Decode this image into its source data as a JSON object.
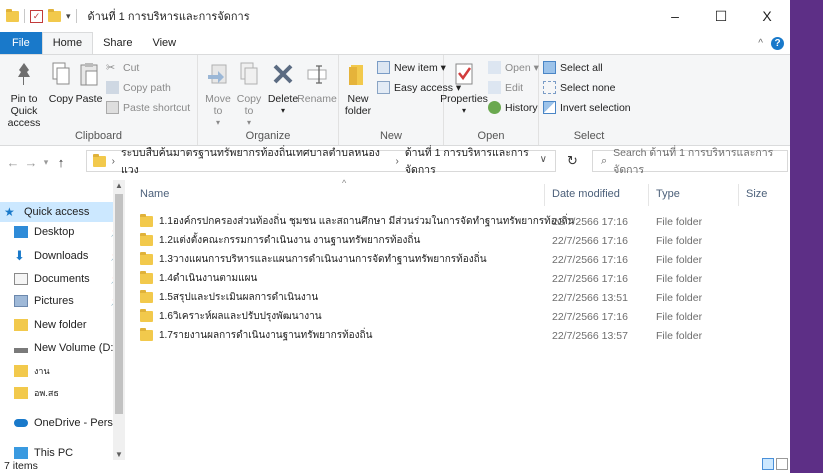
{
  "window": {
    "title": "ด้านที่ 1 การบริหารและการจัดการ",
    "controls": {
      "minimize": "–",
      "maximize": "☐",
      "close": "X"
    }
  },
  "ribbon_tabs": [
    "File",
    "Home",
    "Share",
    "View"
  ],
  "ribbon": {
    "clipboard": {
      "label": "Clipboard",
      "pin_to_quick_access": "Pin to Quick access",
      "copy": "Copy",
      "paste": "Paste",
      "cut": "Cut",
      "copy_path": "Copy path",
      "paste_shortcut": "Paste shortcut"
    },
    "organize": {
      "label": "Organize",
      "move_to": "Move to",
      "copy_to": "Copy to",
      "delete": "Delete",
      "rename": "Rename"
    },
    "new": {
      "label": "New",
      "new_folder": "New folder",
      "new_item": "New item ▾",
      "easy_access": "Easy access ▾"
    },
    "open": {
      "label": "Open",
      "properties": "Properties",
      "open": "Open ▾",
      "edit": "Edit",
      "history": "History"
    },
    "select": {
      "label": "Select",
      "select_all": "Select all",
      "select_none": "Select none",
      "invert_selection": "Invert selection"
    }
  },
  "address": {
    "crumbs": [
      "ระบบสืบค้นมาตรฐานทรัพยากรท้องถิ่นเทศบาลตำบลหนองแวง",
      "ด้านที่ 1 การบริหารและการจัดการ"
    ],
    "search_placeholder": "Search ด้านที่ 1 การบริหารและการจัดการ"
  },
  "nav_items": [
    {
      "label": "Quick access",
      "icon": "star-icon",
      "pinned": false
    },
    {
      "label": "Desktop",
      "icon": "desktop-icon",
      "pinned": true
    },
    {
      "label": "Downloads",
      "icon": "download-icon",
      "pinned": true
    },
    {
      "label": "Documents",
      "icon": "document-icon",
      "pinned": true
    },
    {
      "label": "Pictures",
      "icon": "pictures-icon",
      "pinned": true
    },
    {
      "label": "New folder",
      "icon": "folder-icon",
      "pinned": false
    },
    {
      "label": "New Volume (D:",
      "icon": "drive-icon",
      "pinned": false
    },
    {
      "label": "งาน",
      "icon": "folder-icon",
      "pinned": false
    },
    {
      "label": "อพ.สธ",
      "icon": "folder-icon",
      "pinned": false
    },
    {
      "label": "OneDrive - Persor",
      "icon": "cloud-icon",
      "pinned": false
    },
    {
      "label": "This PC",
      "icon": "pc-icon",
      "pinned": false
    }
  ],
  "columns": {
    "name": "Name",
    "date_modified": "Date modified",
    "type": "Type",
    "size": "Size"
  },
  "files": [
    {
      "name": "1.1องค์กรปกครองส่วนท้องถิ่น ชุมชน และสถานศึกษา มีส่วนร่วมในการจัดทำฐานทรัพยากรท้องถิ่น",
      "date": "22/7/2566 17:16",
      "type": "File folder"
    },
    {
      "name": "1.2แต่งตั้งคณะกรรมการดำเนินงาน งานฐานทรัพยากรท้องถิ่น",
      "date": "22/7/2566 17:16",
      "type": "File folder"
    },
    {
      "name": "1.3วางแผนการบริหารและแผนการดำเนินงานการจัดทำฐานทรัพยากรท้องถิ่น",
      "date": "22/7/2566 17:16",
      "type": "File folder"
    },
    {
      "name": "1.4ดำเนินงานตามแผน",
      "date": "22/7/2566 17:16",
      "type": "File folder"
    },
    {
      "name": "1.5สรุปและประเมินผลการดำเนินงาน",
      "date": "22/7/2566 13:51",
      "type": "File folder"
    },
    {
      "name": "1.6วิเคราะห์ผลและปรับปรุงพัฒนางาน",
      "date": "22/7/2566 17:16",
      "type": "File folder"
    },
    {
      "name": "1.7รายงานผลการดำเนินงานฐานทรัพยากรท้องถิ่น",
      "date": "22/7/2566 13:57",
      "type": "File folder"
    }
  ],
  "status": {
    "item_count": "7 items"
  },
  "colors": {
    "file_tab": "#1979ca",
    "selected_nav": "#cce8ff",
    "folder": "#f2c94c",
    "desktop_border": "#5d2f86"
  }
}
